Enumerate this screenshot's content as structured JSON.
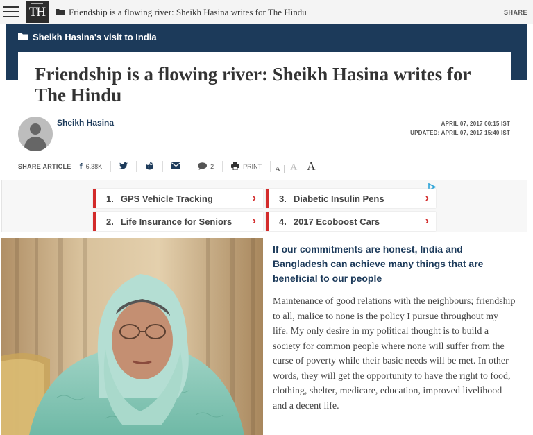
{
  "topbar": {
    "logo": "TH",
    "title": "Friendship is a flowing river: Sheikh Hasina writes for The Hindu",
    "share": "SHARE"
  },
  "section": {
    "label": "Sheikh Hasina's visit to India"
  },
  "article": {
    "headline": "Friendship is a flowing river: Sheikh Hasina writes for The Hindu",
    "author": "Sheikh Hasina",
    "published": "APRIL 07, 2017 00:15 IST",
    "updated": "UPDATED: APRIL 07, 2017 15:40 IST",
    "lede": "If our commitments are honest, India and Bangladesh can achieve many things that are beneficial to our people",
    "body": "Maintenance of good relations with the neighbours; friendship to all, malice to none is the policy I pursue throughout my life. My only desire in my political thought is to build a society for common people where none will suffer from the curse of poverty while their basic needs will be met. In other words, they will get the opportunity to have the right to food, clothing, shelter, medicare, education, improved livelihood and a decent life."
  },
  "share_bar": {
    "label": "SHARE ARTICLE",
    "facebook_count": "6.38K",
    "comment_count": "2",
    "print": "PRINT",
    "font_small": "A",
    "font_medium": "A",
    "font_large": "A"
  },
  "ads": [
    {
      "num": "1.",
      "label": "GPS Vehicle Tracking"
    },
    {
      "num": "3.",
      "label": "Diabetic Insulin Pens"
    },
    {
      "num": "2.",
      "label": "Life Insurance for Seniors"
    },
    {
      "num": "4.",
      "label": "2017 Ecoboost Cars"
    }
  ],
  "colors": {
    "navy": "#1c3a5a",
    "ad_red": "#d32b2b"
  }
}
